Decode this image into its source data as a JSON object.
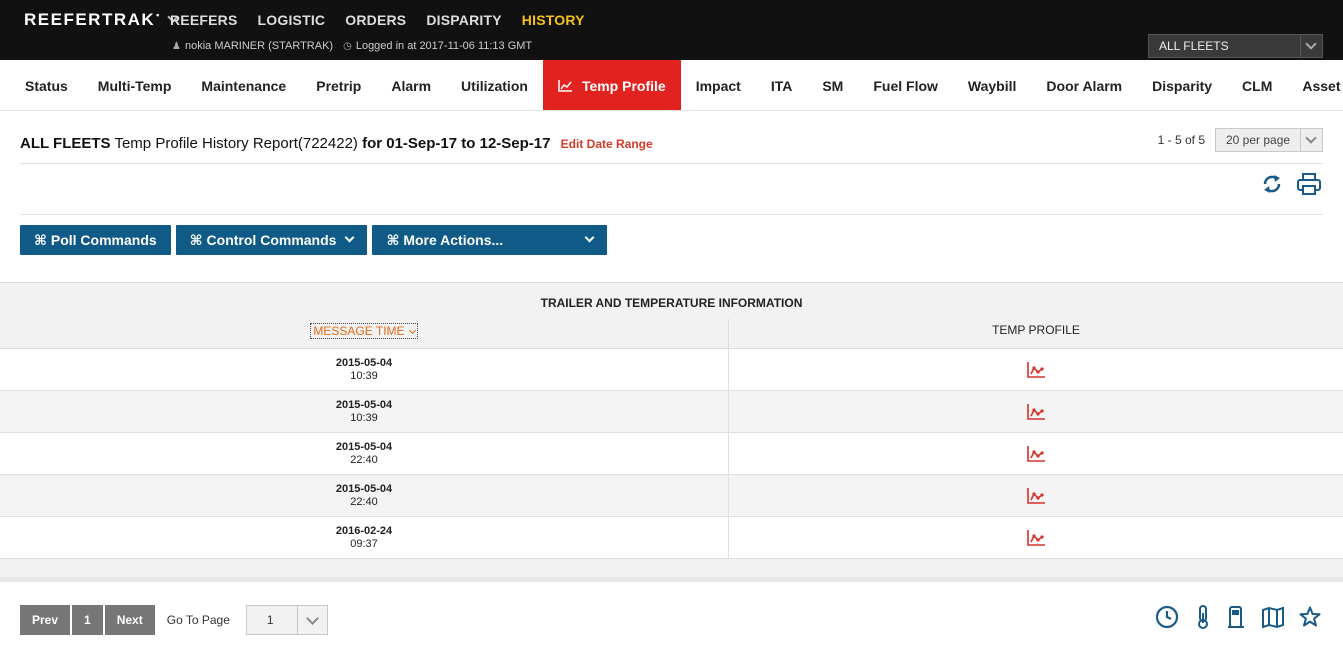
{
  "brand": {
    "name": "REEFERTRAK",
    "mark": "•"
  },
  "topnav": [
    {
      "label": "REEFERS",
      "active": false
    },
    {
      "label": "LOGISTIC",
      "active": false
    },
    {
      "label": "ORDERS",
      "active": false
    },
    {
      "label": "DISPARITY",
      "active": false
    },
    {
      "label": "HISTORY",
      "active": true
    }
  ],
  "user": {
    "name": "nokia MARINER (STARTRAK)",
    "login": "Logged in at 2017-11-06 11:13 GMT"
  },
  "fleet_select": {
    "value": "ALL FLEETS"
  },
  "tabs": [
    {
      "label": "Status",
      "active": false
    },
    {
      "label": "Multi-Temp",
      "active": false
    },
    {
      "label": "Maintenance",
      "active": false
    },
    {
      "label": "Pretrip",
      "active": false
    },
    {
      "label": "Alarm",
      "active": false
    },
    {
      "label": "Utilization",
      "active": false
    },
    {
      "label": "Temp Profile",
      "active": true
    },
    {
      "label": "Impact",
      "active": false
    },
    {
      "label": "ITA",
      "active": false
    },
    {
      "label": "SM",
      "active": false
    },
    {
      "label": "Fuel Flow",
      "active": false
    },
    {
      "label": "Waybill",
      "active": false
    },
    {
      "label": "Door Alarm",
      "active": false
    },
    {
      "label": "Disparity",
      "active": false
    },
    {
      "label": "CLM",
      "active": false
    },
    {
      "label": "Asset Co",
      "active": false
    }
  ],
  "report": {
    "fleet": "ALL FLEETS",
    "title": "Temp Profile History Report(722422)",
    "range": "for 01-Sep-17 to 12-Sep-17",
    "edit_label": "Edit Date Range"
  },
  "pager_top": {
    "summary": "1 - 5 of 5",
    "per_page": "20 per page"
  },
  "actions": {
    "poll": "⌘ Poll Commands",
    "control": "⌘ Control Commands",
    "more": "⌘ More Actions..."
  },
  "table": {
    "caption": "TRAILER AND TEMPERATURE INFORMATION",
    "col_time": "MESSAGE TIME",
    "col_profile": "TEMP PROFILE",
    "rows": [
      {
        "date": "2015-05-04",
        "time": "10:39"
      },
      {
        "date": "2015-05-04",
        "time": "10:39"
      },
      {
        "date": "2015-05-04",
        "time": "22:40"
      },
      {
        "date": "2015-05-04",
        "time": "22:40"
      },
      {
        "date": "2016-02-24",
        "time": "09:37"
      }
    ]
  },
  "pager_bottom": {
    "prev": "Prev",
    "page": "1",
    "next": "Next",
    "goto_label": "Go To Page",
    "goto_value": "1"
  },
  "colors": {
    "accent": "#e2221f",
    "nav_active": "#f4c21b",
    "button": "#0f5a87",
    "icon_blue": "#1a5a86"
  },
  "icons": [
    "refresh-icon",
    "print-icon",
    "clock-icon",
    "thermometer-icon",
    "fuel-icon",
    "map-icon",
    "star-icon",
    "chart-icon"
  ]
}
